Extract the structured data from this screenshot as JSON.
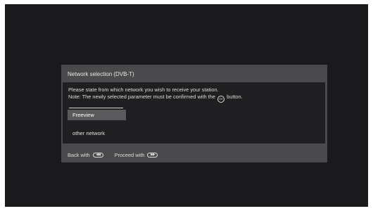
{
  "dialog": {
    "title": "Network selection (DVB-T)",
    "description_line1": "Please state from which network you wish to receive your station.",
    "description_line2_before": "Note: The newly selected parameter must be confirmed with the",
    "description_line2_after": "button.",
    "ok_icon_text": "OK",
    "options": [
      {
        "label": "Freeview",
        "selected": true
      },
      {
        "label": "other network",
        "selected": false
      }
    ],
    "footer": {
      "back_label": "Back with",
      "back_icon": "rewind-key-icon",
      "proceed_label": "Proceed with",
      "proceed_icon": "fast-forward-key-icon"
    }
  },
  "colors": {
    "screen_background": "#1a1a1c",
    "dialog_background": "#4a4a4c",
    "body_background": "#1f1f21",
    "selected_background": "#5a5a5c"
  }
}
